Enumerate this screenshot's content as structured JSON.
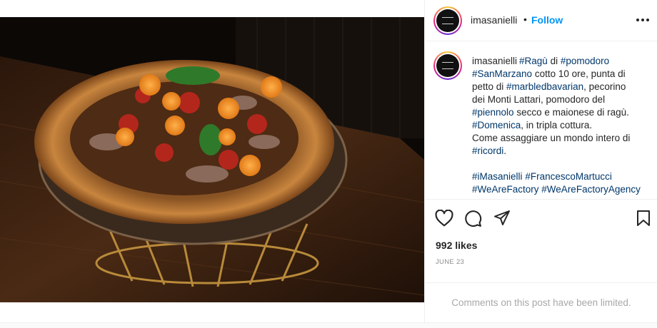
{
  "post": {
    "username": "imasanielli",
    "separator": "•",
    "follow_label": "Follow",
    "caption": {
      "username": "imasanielli",
      "lines": [
        [
          {
            "t": "tag",
            "v": "#Ragù"
          },
          {
            "t": "text",
            "v": " di "
          },
          {
            "t": "tag",
            "v": "#pomodoro"
          }
        ],
        [
          {
            "t": "tag",
            "v": "#SanMarzano"
          },
          {
            "t": "text",
            "v": " cotto 10 ore, punta di"
          }
        ],
        [
          {
            "t": "text",
            "v": "petto di "
          },
          {
            "t": "tag",
            "v": "#marbledbavarian"
          },
          {
            "t": "text",
            "v": ", pecorino"
          }
        ],
        [
          {
            "t": "text",
            "v": "dei Monti Lattari, pomodoro del"
          }
        ],
        [
          {
            "t": "tag",
            "v": "#piennolo"
          },
          {
            "t": "text",
            "v": " secco e maionese di ragù."
          }
        ],
        [
          {
            "t": "tag",
            "v": "#Domenica"
          },
          {
            "t": "text",
            "v": ", in tripla cottura."
          }
        ],
        [
          {
            "t": "text",
            "v": "Come assaggiare un mondo intero di"
          }
        ],
        [
          {
            "t": "tag",
            "v": "#ricordi"
          },
          {
            "t": "text",
            "v": "."
          }
        ],
        [],
        [
          {
            "t": "tag",
            "v": "#iMasanielli"
          },
          {
            "t": "text",
            "v": " "
          },
          {
            "t": "tag",
            "v": "#FrancescoMartucci"
          }
        ],
        [
          {
            "t": "tag",
            "v": "#WeAreFactory"
          },
          {
            "t": "text",
            "v": " "
          },
          {
            "t": "tag",
            "v": "#WeAreFactoryAgency"
          }
        ]
      ]
    },
    "likes": "992 likes",
    "date": "JUNE 23",
    "comments_limited": "Comments on this post have been limited."
  },
  "icons": {
    "like": "heart-icon",
    "comment": "comment-icon",
    "share": "share-icon",
    "save": "bookmark-icon",
    "more": "more-options-icon"
  },
  "colors": {
    "link": "#0095f6",
    "hashtag": "#00376b",
    "muted": "#8e8e8e"
  }
}
